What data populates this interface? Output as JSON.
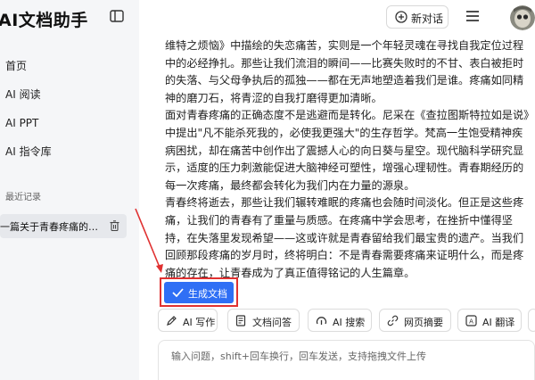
{
  "sidebar": {
    "app_title": "AI文档助手",
    "nav": [
      "首页",
      "AI 阅读",
      "AI PPT",
      "AI 指令库"
    ],
    "recent_title": "最近记录",
    "recent_item": "一篇关于青春疼痛的文章"
  },
  "topbar": {
    "new_chat_label": "新对话"
  },
  "content": {
    "paragraphs": [
      "维特之烦恼》中描绘的失恋痛苦，实则是一个年轻灵魂在寻找自我定位过程中的必经挣扎。那些让我们流泪的瞬间——比赛失败时的不甘、表白被拒时的失落、与父母争执后的孤独——都在无声地塑造着我们是谁。疼痛如同精神的磨刀石，将青涩的自我打磨得更加清晰。",
      "面对青春疼痛的正确态度不是逃避而是转化。尼采在《查拉图斯特拉如是说》中提出\"凡不能杀死我的，必使我更强大\"的生存哲学。梵高一生饱受精神疾病困扰，却在痛苦中创作出了震撼人心的向日葵与星空。现代脑科学研究显示，适度的压力刺激能促进大脑神经可塑性，增强心理韧性。青春期经历的每一次疼痛，最终都会转化为我们内在力量的源泉。",
      "青春终将逝去，那些让我们辗转难眠的疼痛也会随时间淡化。但正是这些疼痛，让我们的青春有了重量与质感。在疼痛中学会思考，在挫折中懂得坚持，在失落里发现希望——这或许就是青春留给我们最宝贵的遗产。当我们回顾那段疼痛的岁月时，终将明白：不是青春需要疼痛来证明什么，而是疼痛的存在，让青春成为了真正值得铭记的人生篇章。"
    ]
  },
  "actions": {
    "generate_label": "生成文档"
  },
  "tools": [
    "AI 写作",
    "文档问答",
    "AI 搜索",
    "网页摘要",
    "AI 翻译"
  ],
  "input": {
    "placeholder": "输入问题，shift+回车换行，回车发送，支持拖拽文件上传"
  },
  "colors": {
    "accent": "#2f6ff5",
    "highlight": "#e03131"
  },
  "icons": [
    "sidebar-collapse-icon",
    "plus-circle-icon",
    "menu-icon",
    "trash-icon",
    "check-icon",
    "pen-icon",
    "doc-icon",
    "search-icon",
    "link-icon",
    "translate-icon"
  ]
}
